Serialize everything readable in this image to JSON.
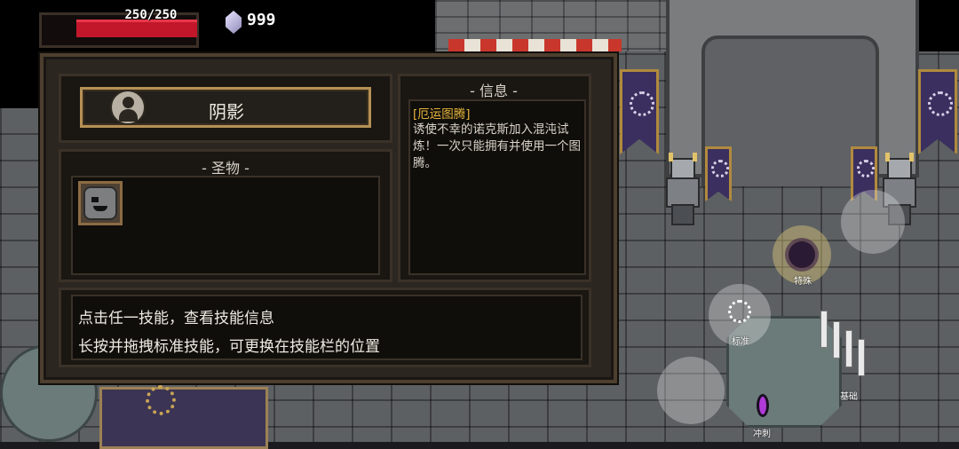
{
  "hud": {
    "hp": "250/250",
    "hp_fraction": 1.0,
    "gems": "999",
    "icons": {
      "gem": "gem-icon"
    }
  },
  "panel": {
    "skill_name": "阴影",
    "relic_title": "- 圣物 -",
    "info_title": "- 信息 -",
    "info": {
      "name": "[厄运图腾]",
      "description": "诱使不幸的诺克斯加入混沌试炼！一次只能拥有并使用一个图腾。"
    },
    "tips": [
      "点击任一技能，查看技能信息",
      "长按并拖拽标准技能，可更换在技能栏的位置"
    ]
  },
  "controls": {
    "special": "特殊",
    "standard": "标准",
    "basic": "基础",
    "dash": "冲刺"
  },
  "colors": {
    "hp": "#c2172a",
    "panel_bg": "#2b2620",
    "gold_border": "#b69155",
    "info_name": "#e5b33a",
    "banner": "#3a2f5e"
  }
}
